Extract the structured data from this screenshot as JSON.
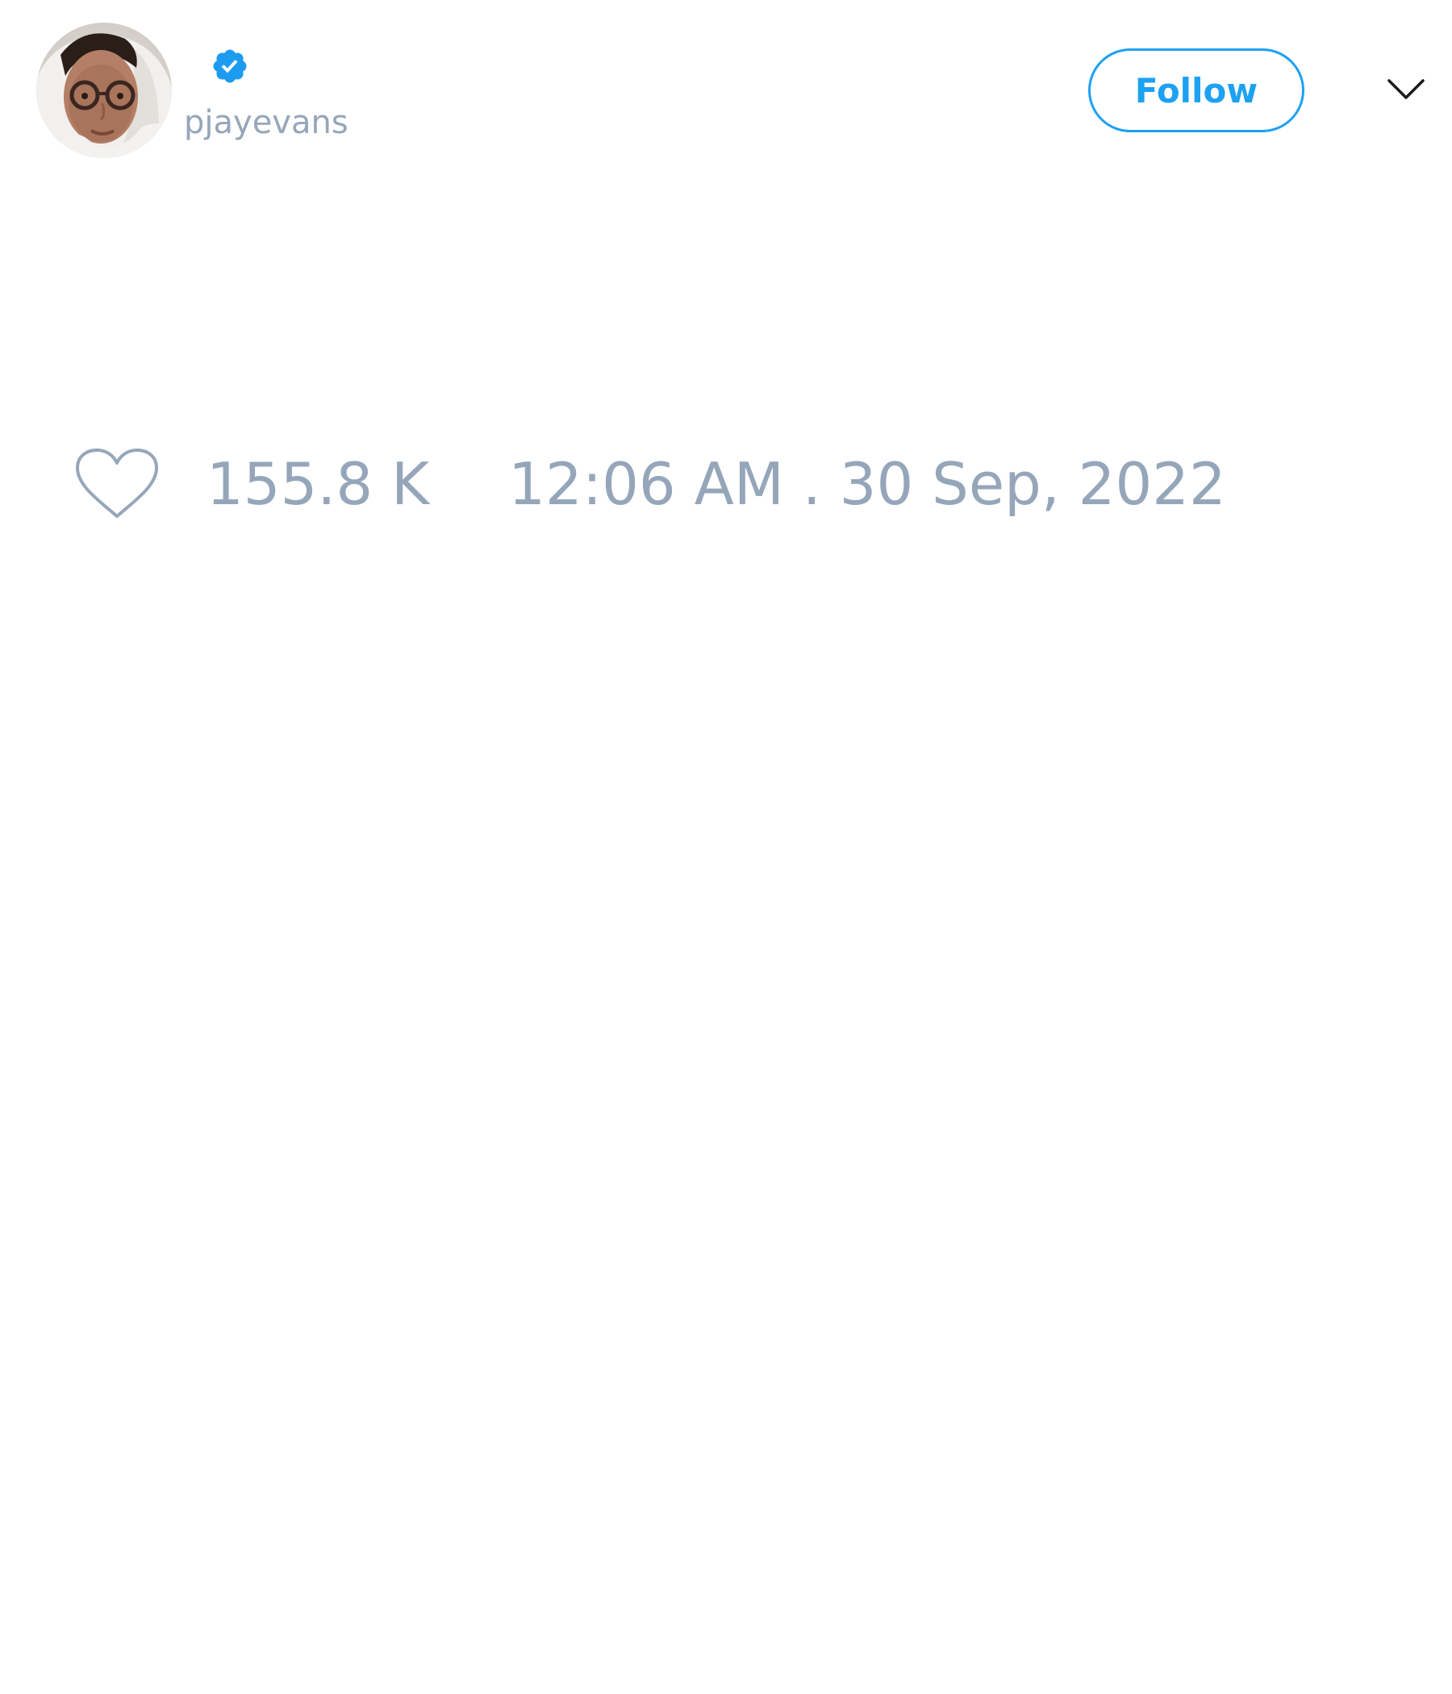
{
  "user": {
    "handle": "pjayevans",
    "verified": true,
    "avatar": "profile-photo"
  },
  "actions": {
    "follow_label": "Follow",
    "menu_icon": "chevron-down-icon"
  },
  "stats": {
    "like_icon": "heart-outline-icon",
    "likes": "155.8 K",
    "timestamp": "12:06 AM . 30 Sep, 2022"
  },
  "colors": {
    "accent": "#1da1f2",
    "muted_text": "#96a6ba",
    "background": "#ffffff"
  }
}
